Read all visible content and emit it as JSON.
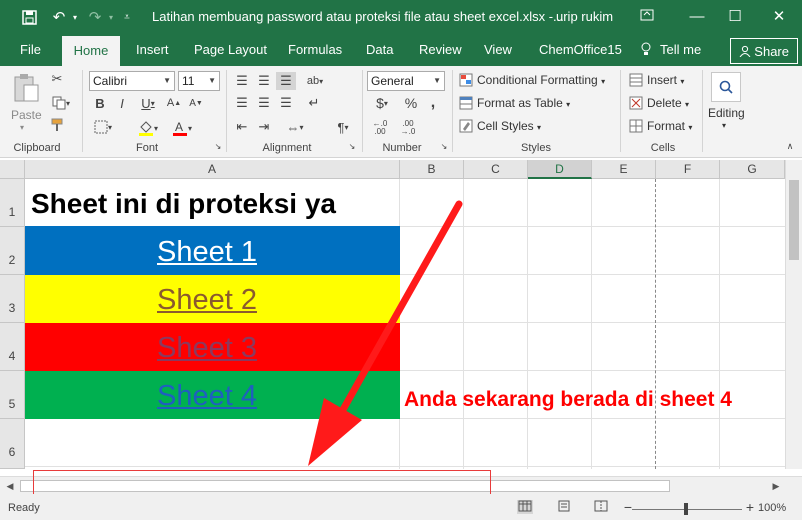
{
  "window": {
    "title": "Latihan membuang password atau proteksi file atau sheet excel.xlsx  -...",
    "user": "urip rukim"
  },
  "tabs": [
    "File",
    "Home",
    "Insert",
    "Page Layout",
    "Formulas",
    "Data",
    "Review",
    "View",
    "ChemOffice15"
  ],
  "tell_me": "Tell me",
  "share": "Share",
  "ribbon": {
    "clipboard": {
      "label": "Clipboard",
      "paste": "Paste"
    },
    "font": {
      "label": "Font",
      "name": "Calibri",
      "size": "11"
    },
    "alignment": {
      "label": "Alignment"
    },
    "number": {
      "label": "Number",
      "format": "General"
    },
    "styles": {
      "label": "Styles",
      "conditional": "Conditional Formatting",
      "table": "Format as Table",
      "cell": "Cell Styles"
    },
    "cells": {
      "label": "Cells",
      "insert": "Insert",
      "delete": "Delete",
      "format": "Format"
    },
    "editing": {
      "label": "Editing"
    }
  },
  "columns": [
    "A",
    "B",
    "C",
    "D",
    "E",
    "F",
    "G"
  ],
  "rows": [
    "1",
    "2",
    "3",
    "4",
    "5",
    "6"
  ],
  "cells": {
    "a1": "Sheet ini di proteksi ya",
    "a2": "Sheet 1",
    "a3": "Sheet 2",
    "a4": "Sheet 3",
    "a5": "Sheet 4",
    "note": "Anda sekarang berada di sheet 4"
  },
  "colors": {
    "brand": "#217346",
    "row2": "#0070c0",
    "row3": "#ffff00",
    "row4": "#ff0000",
    "row5": "#00b050",
    "annotation": "#ff0000"
  },
  "status": {
    "ready": "Ready",
    "zoom": "100%"
  }
}
